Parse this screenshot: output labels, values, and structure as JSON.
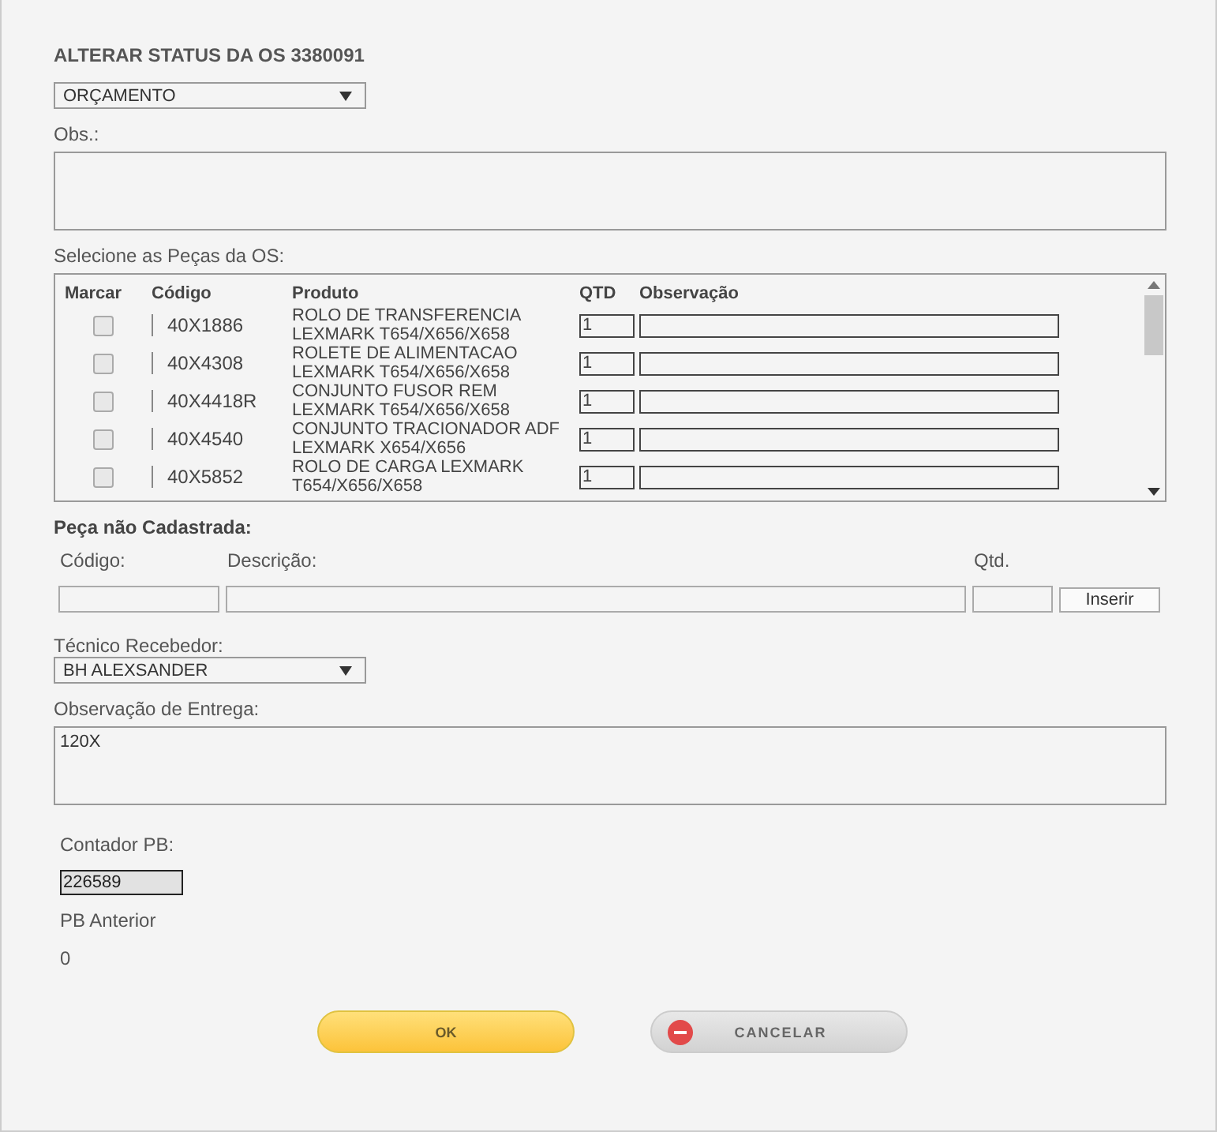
{
  "title": "ALTERAR STATUS DA OS 3380091",
  "status_select": {
    "value": "ORÇAMENTO"
  },
  "obs": {
    "label": "Obs.:"
  },
  "parts": {
    "label": "Selecione as Peças da OS:",
    "columns": [
      "Marcar",
      "Código",
      "Produto",
      "QTD",
      "Observação"
    ],
    "rows": [
      {
        "checked": false,
        "code": "40X1886",
        "product": [
          "ROLO DE TRANSFERENCIA",
          "LEXMARK T654/X656/X658"
        ],
        "qty": "1"
      },
      {
        "checked": false,
        "code": "40X4308",
        "product": [
          "ROLETE DE ALIMENTACAO",
          "LEXMARK T654/X656/X658"
        ],
        "qty": "1"
      },
      {
        "checked": false,
        "code": "40X4418R",
        "product": [
          "CONJUNTO FUSOR REM",
          "LEXMARK T654/X656/X658"
        ],
        "qty": "1"
      },
      {
        "checked": false,
        "code": "40X4540",
        "product": [
          "CONJUNTO TRACIONADOR ADF",
          "LEXMARK X654/X656"
        ],
        "qty": "1"
      },
      {
        "checked": false,
        "code": "40X5852",
        "product": [
          "ROLO DE CARGA LEXMARK",
          "T654/X656/X658"
        ],
        "qty": "1"
      }
    ]
  },
  "unregistered": {
    "heading": "Peça não Cadastrada:",
    "code_label": "Código:",
    "desc_label": "Descrição:",
    "qty_label": "Qtd.",
    "insert_button": "Inserir"
  },
  "technician": {
    "label": "Técnico Recebedor:",
    "value": "BH ALEXSANDER"
  },
  "delivery_obs": {
    "label": "Observação de Entrega:",
    "value": "120X"
  },
  "counter": {
    "label": "Contador PB:",
    "value": "226589"
  },
  "previous": {
    "label": "PB Anterior",
    "value": "0"
  },
  "buttons": {
    "ok": "OK",
    "cancel": "CANCELAR"
  }
}
